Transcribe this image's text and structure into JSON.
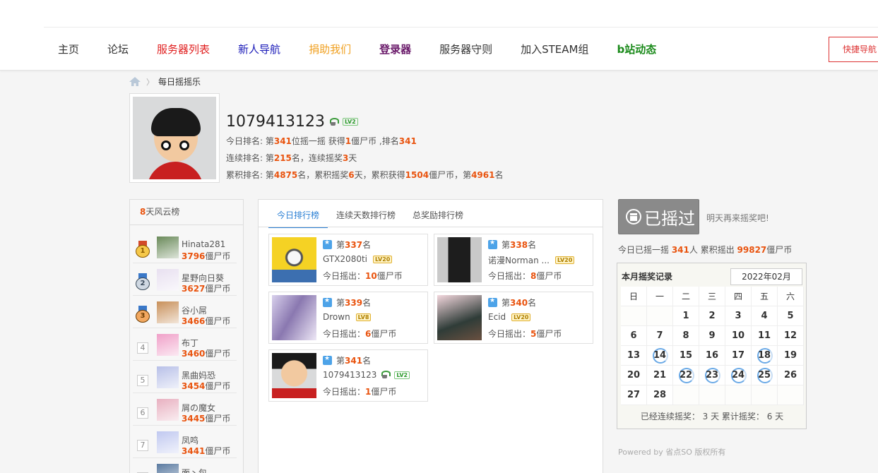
{
  "nav": {
    "items": [
      {
        "label": "主页",
        "color": "#333333"
      },
      {
        "label": "论坛",
        "color": "#333333"
      },
      {
        "label": "服务器列表",
        "color": "#e02020"
      },
      {
        "label": "新人导航",
        "color": "#1a1ab8"
      },
      {
        "label": "捐助我们",
        "color": "#f0a020"
      },
      {
        "label": "登录器",
        "color": "#6a1a6a",
        "bold": true
      },
      {
        "label": "服务器守则",
        "color": "#333333"
      },
      {
        "label": "加入STEAM组",
        "color": "#333333"
      },
      {
        "label": "b站动态",
        "color": "#1a8a1a",
        "bold": true
      }
    ],
    "quick_label": "快捷导航"
  },
  "breadcrumb": {
    "sep": "〉",
    "current": "每日摇摇乐"
  },
  "profile": {
    "name": "1079413123",
    "level": "LV2",
    "today": {
      "p1": "今日排名: 第",
      "rank": "341",
      "p2": "位摇一摇 获得",
      "coins": "1",
      "p3": "僵尸币 ,排名",
      "rank2": "341"
    },
    "streak": {
      "p1": "连续排名: 第",
      "rank": "215",
      "p2": "名，连续摇奖",
      "days": "3",
      "p3": "天"
    },
    "total": {
      "p1": "累积排名: 第",
      "rank": "4875",
      "p2": "名，累积摇奖",
      "days": "6",
      "p3": "天，累积获得",
      "coins": "1504",
      "p4": "僵尸币，第",
      "rank2": "4961",
      "p5": "名"
    }
  },
  "leaderboard": {
    "title_num": "8",
    "title_text": "天风云榜",
    "unit": "僵尸币",
    "rows": [
      {
        "pos": "1",
        "name": "Hinata281",
        "coins": "3796",
        "medal": "gold"
      },
      {
        "pos": "2",
        "name": "星野向日葵",
        "coins": "3627",
        "medal": "silver"
      },
      {
        "pos": "3",
        "name": "谷小屌",
        "coins": "3466",
        "medal": "bronze"
      },
      {
        "pos": "4",
        "name": "布丁",
        "coins": "3460"
      },
      {
        "pos": "5",
        "name": "黑曲妈恐",
        "coins": "3454"
      },
      {
        "pos": "6",
        "name": "屑の魔女",
        "coins": "3445"
      },
      {
        "pos": "7",
        "name": "凤鸣",
        "coins": "3441"
      },
      {
        "pos": "8",
        "name": "面丶包",
        "coins": ""
      }
    ]
  },
  "tabs": [
    "今日排行榜",
    "连续天数排行榜",
    "总奖励排行榜"
  ],
  "cards": [
    {
      "rank": "337",
      "name": "GTX2080ti",
      "level": "LV20",
      "gold": true,
      "coins": "10",
      "av": "minion"
    },
    {
      "rank": "338",
      "name": "诺漫Norman ...",
      "level": "LV20",
      "gold": true,
      "coins": "8",
      "av": "suit"
    },
    {
      "rank": "339",
      "name": "Drown",
      "level": "LV8",
      "gold": true,
      "coins": "6",
      "av": "window"
    },
    {
      "rank": "340",
      "name": "Ecid",
      "level": "LV20",
      "gold": true,
      "coins": "5",
      "av": "anime"
    },
    {
      "rank": "341",
      "name": "1079413123",
      "level": "LV2",
      "gold": false,
      "coins": "1",
      "av": "boy"
    }
  ],
  "card_text": {
    "prefix": "第",
    "suffix": "名",
    "today_prefix": "今日摇出：",
    "unit": "僵尸币"
  },
  "shake": {
    "button_label": "已摇过",
    "tomorrow": "明天再来摇奖吧!",
    "today_p1": "今日已摇一摇 ",
    "today_count": "341",
    "today_p2": "人 累积摇出 ",
    "today_total": "99827",
    "today_p3": "僵尸币"
  },
  "calendar": {
    "title": "本月摇奖记录",
    "month": "2022年02月",
    "weekdays": [
      "日",
      "一",
      "二",
      "三",
      "四",
      "五",
      "六"
    ],
    "rows": [
      [
        "",
        "",
        "1",
        "2",
        "3",
        "4",
        "5"
      ],
      [
        "6",
        "7",
        "8",
        "9",
        "10",
        "11",
        "12"
      ],
      [
        "13",
        "14",
        "15",
        "16",
        "17",
        "18",
        "19"
      ],
      [
        "20",
        "21",
        "22",
        "23",
        "24",
        "25",
        "26"
      ],
      [
        "27",
        "28",
        "",
        "",
        "",
        "",
        ""
      ]
    ],
    "marked": [
      "14",
      "18",
      "22",
      "23",
      "24",
      "25"
    ],
    "footer": "已经连续摇奖： 3 天 累计摇奖： 6 天"
  },
  "footer": "Powered by 省点SO 版权所有"
}
